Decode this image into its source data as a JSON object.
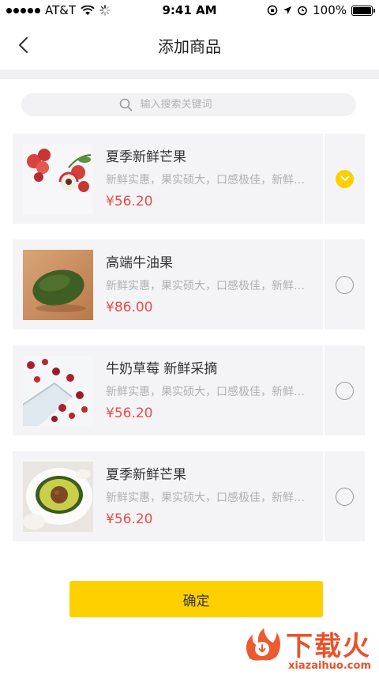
{
  "status_bar": {
    "carrier": "AT&T",
    "time": "9:41 AM",
    "battery": "100%"
  },
  "header": {
    "title": "添加商品"
  },
  "search": {
    "placeholder": "输入搜索关键词"
  },
  "products": [
    {
      "name": "夏季新鲜芒果",
      "desc": "新鲜实惠，果实硕大，口感极佳，新鲜采摘",
      "price": "¥56.20",
      "selected": true,
      "image": "lychee-photo"
    },
    {
      "name": "高端牛油果",
      "desc": "新鲜实惠，果实硕大，口感极佳，新鲜采摘",
      "price": "¥86.00",
      "selected": false,
      "image": "avocado-photo"
    },
    {
      "name": "牛奶草莓 新鲜采摘",
      "desc": "新鲜实惠，果实硕大，口感极佳，新鲜采摘",
      "price": "¥56.20",
      "selected": false,
      "image": "cranberry-photo"
    },
    {
      "name": "夏季新鲜芒果",
      "desc": "新鲜实惠，果实硕大，口感极佳，新鲜采摘",
      "price": "¥56.20",
      "selected": false,
      "image": "avocado-half-photo"
    }
  ],
  "confirm_label": "确定",
  "watermark": {
    "text": "下载火",
    "url": "xiazaihuo.com"
  },
  "colors": {
    "accent": "#ffd000",
    "price": "#e94b4b",
    "card_bg": "#f4f4f7"
  }
}
